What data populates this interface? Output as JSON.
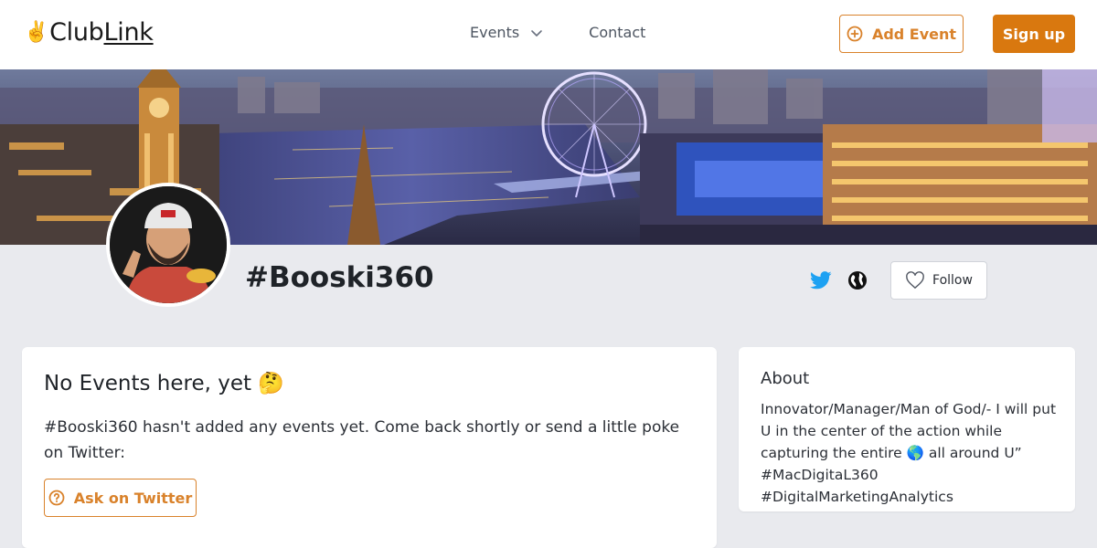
{
  "header": {
    "logo_emoji": "✌️",
    "logo_text_a": "Club",
    "logo_text_b": "Link",
    "nav": {
      "events_label": "Events",
      "contact_label": "Contact"
    },
    "add_event_label": "Add Event",
    "signup_label": "Sign up"
  },
  "profile": {
    "name": "#Booski360",
    "follow_label": "Follow"
  },
  "events_card": {
    "title": "No Events here, yet 🤔",
    "message": "#Booski360 hasn't added any events yet. Come back shortly or send a little poke on Twitter:",
    "ask_button_label": "Ask on Twitter"
  },
  "about_card": {
    "title": "About",
    "text": "Innovator/Manager/Man of God/- I will put U in the center of the action while capturing the entire 🌎 all around U” #MacDigitaL360 #DigitalMarketingAnalytics"
  },
  "icons": {
    "add_event": "plus-circle-icon",
    "events_dropdown": "chevron-down-icon",
    "twitter": "twitter-icon",
    "website": "globe-icon",
    "follow": "heart-icon",
    "ask": "question-circle-icon"
  },
  "colors": {
    "accent": "#d9822b",
    "accent_solid": "#d9780f",
    "twitter": "#1da1f2",
    "page_bg": "#e9eaee"
  }
}
